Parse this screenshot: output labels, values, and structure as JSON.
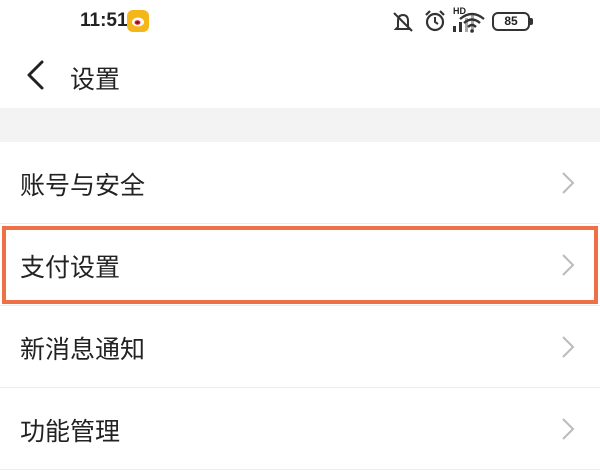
{
  "status_bar": {
    "time": "11:51",
    "battery_level": "85",
    "hd_label": "HD",
    "icons": [
      "weibo-icon",
      "mute-icon",
      "alarm-icon",
      "signal-icon",
      "wifi-icon",
      "battery-icon"
    ]
  },
  "header": {
    "title": "设置",
    "back_icon": "chevron-left-icon"
  },
  "menu": {
    "items": [
      {
        "label": "账号与安全",
        "highlighted": false
      },
      {
        "label": "支付设置",
        "highlighted": true
      },
      {
        "label": "新消息通知",
        "highlighted": false
      },
      {
        "label": "功能管理",
        "highlighted": false
      }
    ]
  },
  "colors": {
    "highlight_border": "#ee7046",
    "section_gap": "#f3f3f3",
    "weibo_badge": "#f5b619"
  }
}
